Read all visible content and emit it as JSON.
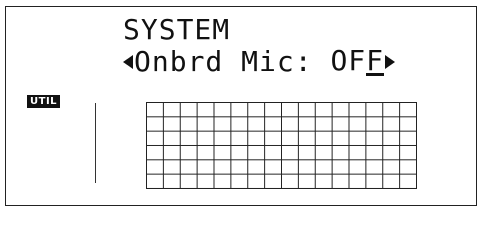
{
  "screen": {
    "title": "SYSTEM",
    "parameter_label": "Onbrd Mic:",
    "parameter_value_main": "OF",
    "parameter_value_cursor": "F",
    "mode_badge": "UTIL"
  },
  "grid": {
    "columns": 16,
    "rows": 6
  },
  "icons": {
    "left_arrow": "left-triangle-icon",
    "right_arrow": "right-triangle-icon"
  },
  "colors": {
    "ink": "#111111",
    "background": "#ffffff"
  }
}
